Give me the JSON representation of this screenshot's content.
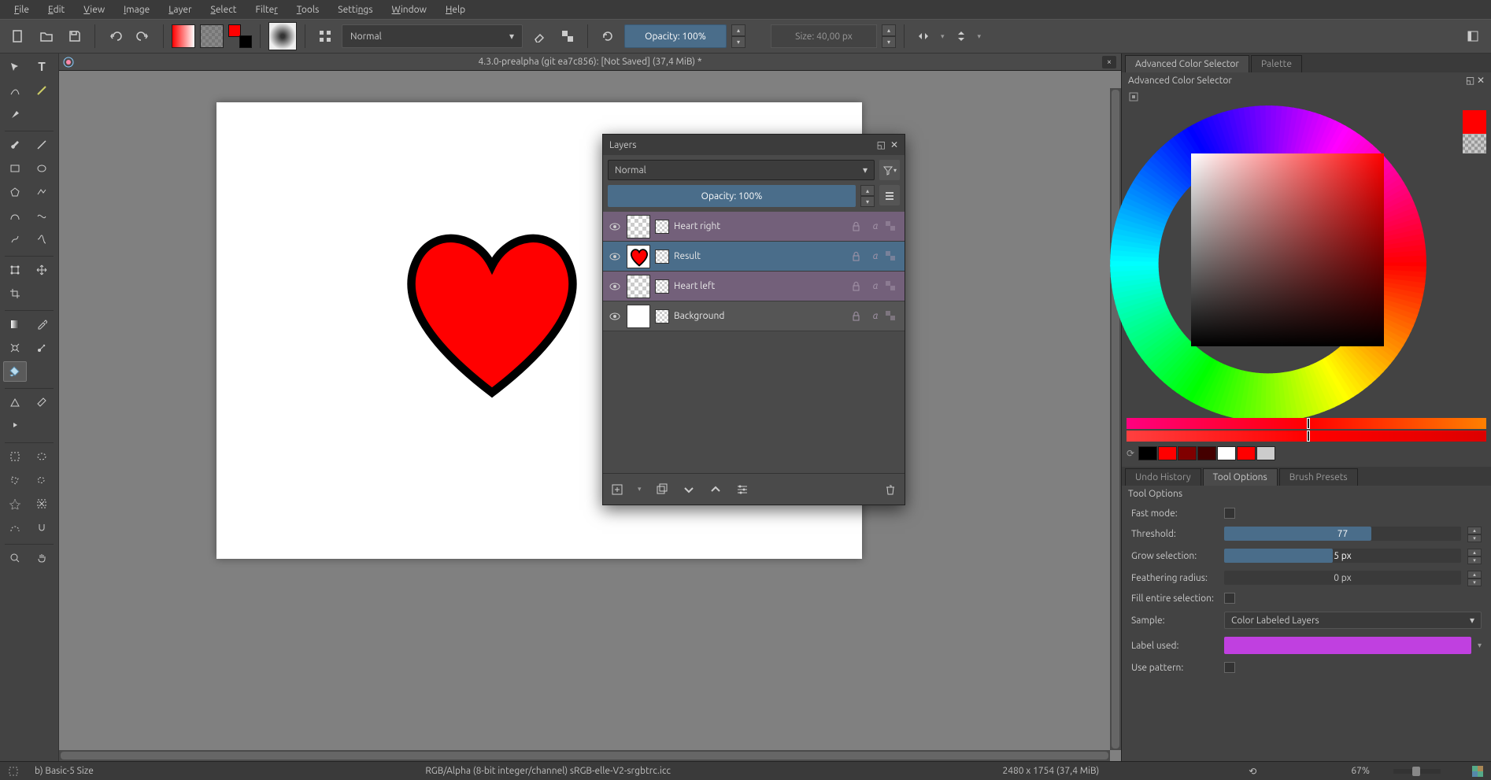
{
  "menu": {
    "file": "File",
    "edit": "Edit",
    "view": "View",
    "image": "Image",
    "layer": "Layer",
    "select": "Select",
    "filter": "Filter",
    "tools": "Tools",
    "settings": "Settings",
    "window": "Window",
    "help": "Help"
  },
  "toolbar": {
    "blend_mode": "Normal",
    "opacity": "Opacity: 100%",
    "size": "Size: 40,00 px"
  },
  "document": {
    "title": "4.3.0-prealpha (git ea7c856):  [Not Saved]  (37,4 MiB) *"
  },
  "layers_panel": {
    "title": "Layers",
    "blend_mode": "Normal",
    "opacity": "Opacity:  100%",
    "items": [
      {
        "name": "Heart right",
        "selected": false,
        "visible": true,
        "bg": false,
        "thumbCheck": true
      },
      {
        "name": "Result",
        "selected": true,
        "visible": true,
        "bg": false,
        "thumbCheck": false,
        "heartThumb": true
      },
      {
        "name": "Heart left",
        "selected": false,
        "visible": true,
        "bg": false,
        "thumbCheck": true
      },
      {
        "name": "Background",
        "selected": false,
        "visible": true,
        "bg": true,
        "thumbCheck": false
      }
    ]
  },
  "right_panel": {
    "tab_acs": "Advanced Color Selector",
    "tab_palette": "Palette",
    "title": "Advanced Color Selector",
    "swatch_colors": [
      "#000000",
      "#ff0000",
      "#800000",
      "#440000",
      "#ffffff",
      "#ff0000",
      "#cccccc"
    ],
    "tab_undo": "Undo History",
    "tab_toolopts": "Tool Options",
    "tab_brush": "Brush Presets",
    "tool_opts_title": "Tool Options",
    "opts": {
      "fast_mode": "Fast mode:",
      "threshold": "Threshold:",
      "threshold_val": "77",
      "threshold_pct": 62,
      "grow": "Grow selection:",
      "grow_val": "5 px",
      "grow_pct": 46,
      "feather": "Feathering radius:",
      "feather_val": "0 px",
      "feather_pct": 0,
      "fill_entire": "Fill entire selection:",
      "sample": "Sample:",
      "sample_val": "Color Labeled Layers",
      "label_used": "Label used:",
      "use_pattern": "Use pattern:"
    }
  },
  "statusbar": {
    "brush": "b) Basic-5 Size",
    "colorspace": "RGB/Alpha (8-bit integer/channel)  sRGB-elle-V2-srgbtrc.icc",
    "dims": "2480 x 1754 (37,4 MiB)",
    "zoom": "67%"
  }
}
